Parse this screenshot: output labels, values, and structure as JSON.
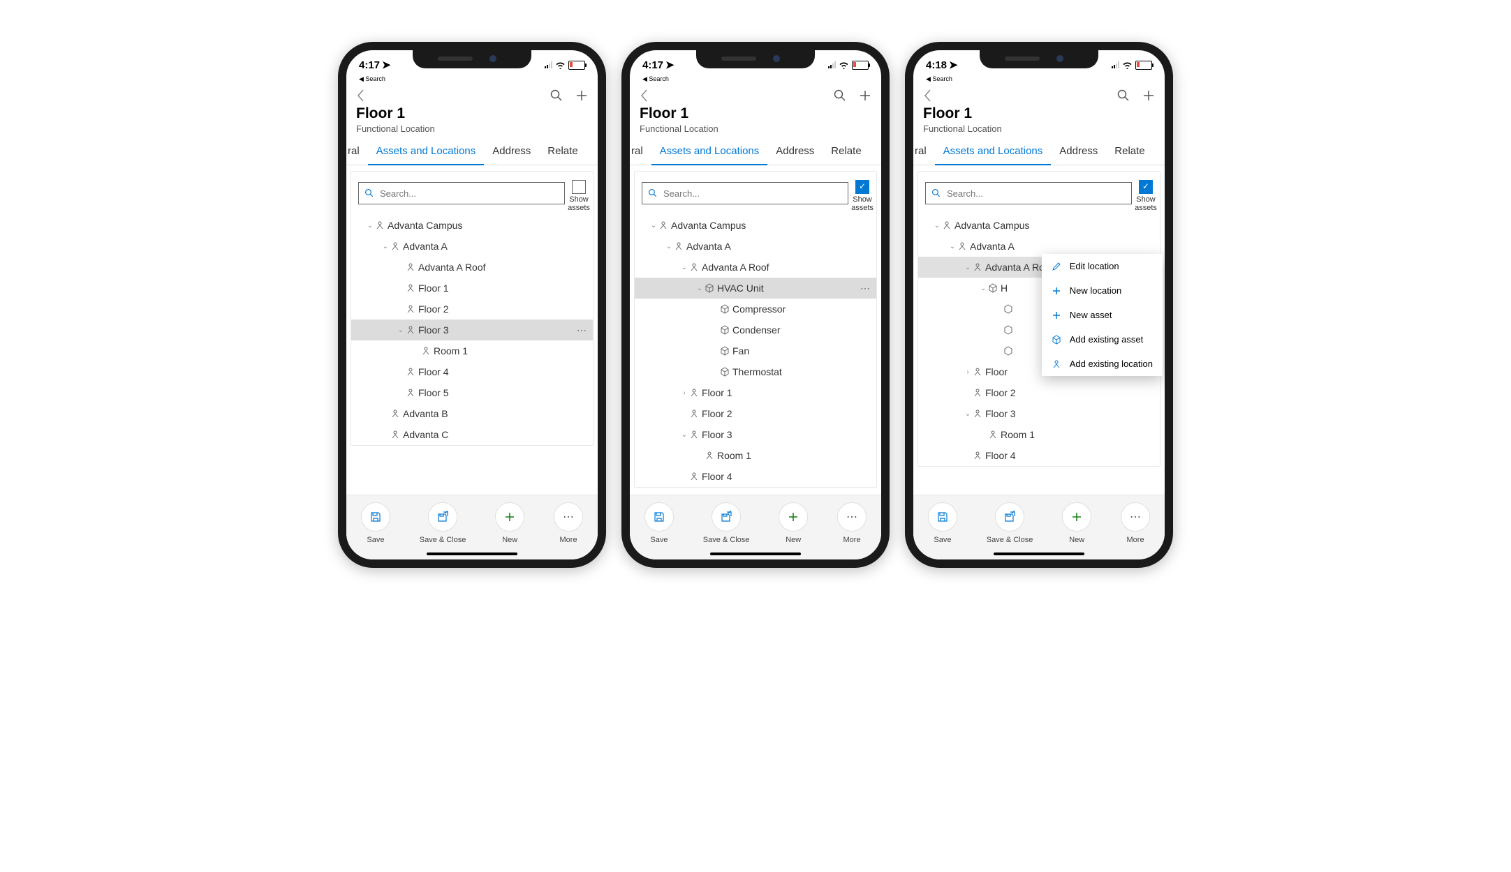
{
  "status": {
    "time1": "4:17",
    "time2": "4:17",
    "time3": "4:18",
    "back": "Search"
  },
  "header": {
    "title": "Floor 1",
    "subtitle": "Functional Location"
  },
  "tabs": {
    "t0": "ral",
    "t1": "Assets and Locations",
    "t2": "Address",
    "t3": "Relate"
  },
  "search": {
    "placeholder": "Search...",
    "chk1": "Show",
    "chk2": "assets"
  },
  "p1": {
    "n0": "Advanta Campus",
    "n1": "Advanta A",
    "n2": "Advanta A Roof",
    "n3": "Floor 1",
    "n4": "Floor 2",
    "n5": "Floor 3",
    "n6": "Room 1",
    "n7": "Floor 4",
    "n8": "Floor 5",
    "n9": "Advanta B",
    "n10": "Advanta C"
  },
  "p2": {
    "n0": "Advanta Campus",
    "n1": "Advanta A",
    "n2": "Advanta A Roof",
    "n3": "HVAC Unit",
    "n4": "Compressor",
    "n5": "Condenser",
    "n6": "Fan",
    "n7": "Thermostat",
    "n8": "Floor 1",
    "n9": "Floor 2",
    "n10": "Floor 3",
    "n11": "Room 1",
    "n12": "Floor 4"
  },
  "p3": {
    "n0": "Advanta Campus",
    "n1": "Advanta A",
    "n2": "Advanta A Roof",
    "n3": "H",
    "n4": "Floor",
    "n5": "Floor 2",
    "n6": "Floor 3",
    "n7": "Room 1",
    "n8": "Floor 4"
  },
  "menu": {
    "m0": "Edit location",
    "m1": "New location",
    "m2": "New asset",
    "m3": "Add existing asset",
    "m4": "Add existing location"
  },
  "actions": {
    "a0": "Save",
    "a1": "Save & Close",
    "a2": "New",
    "a3": "More"
  }
}
